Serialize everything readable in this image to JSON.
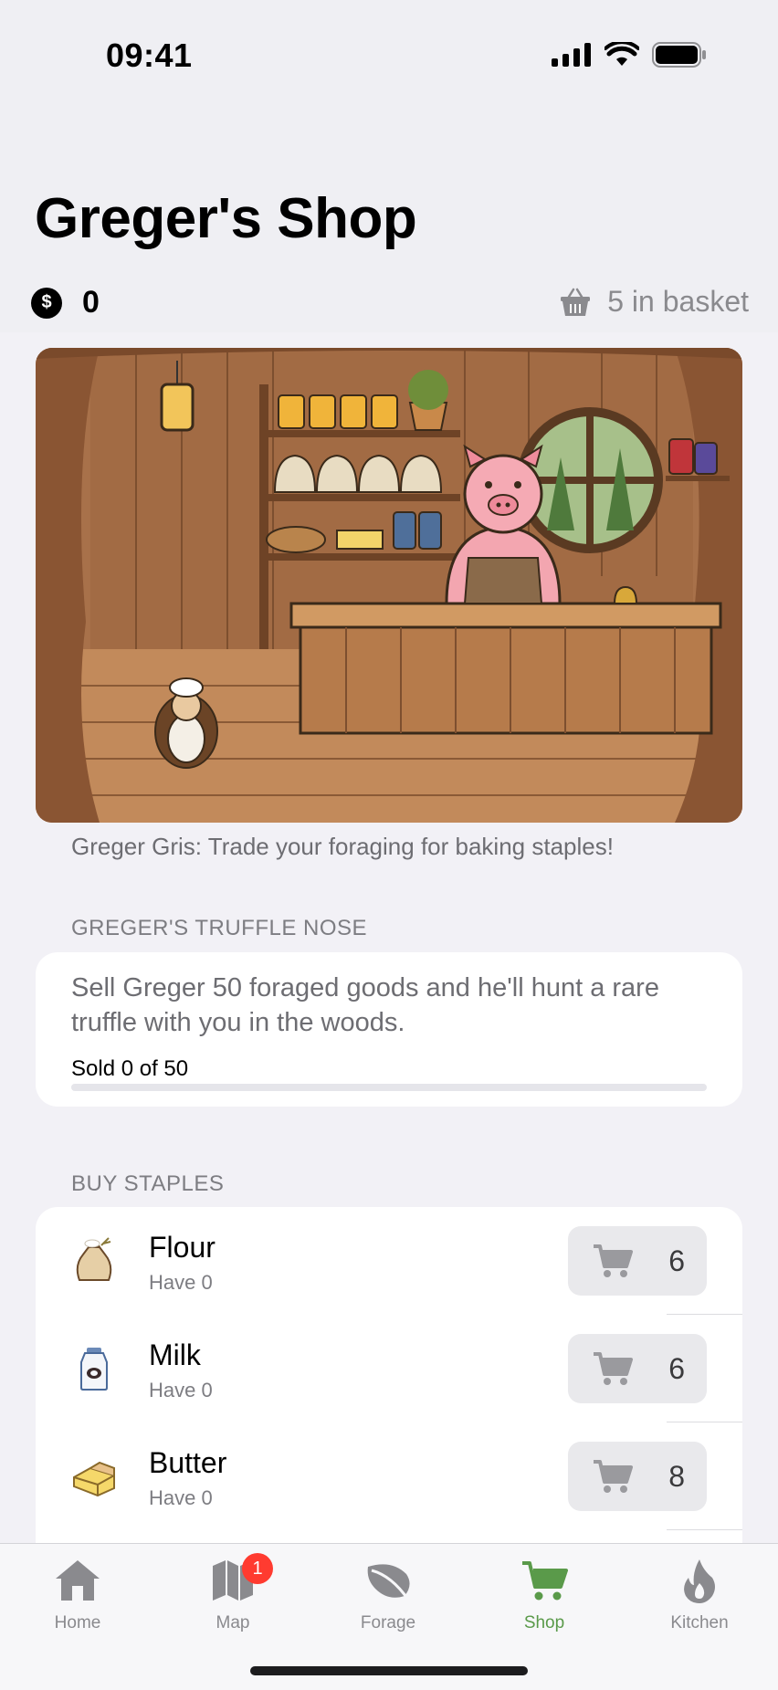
{
  "status": {
    "time": "09:41"
  },
  "header": {
    "title": "Greger's Shop",
    "coins": "0",
    "coin_symbol": "$",
    "basket": "5 in basket"
  },
  "scene": {
    "caption": "Greger Gris: Trade your foraging for baking staples!"
  },
  "truffle": {
    "section_title": "GREGER'S TRUFFLE NOSE",
    "description": "Sell Greger 50 foraged goods and he'll hunt a rare truffle with you in the woods.",
    "sold_label": "Sold 0 of 50",
    "progress": 0
  },
  "staples": {
    "section_title": "BUY STAPLES",
    "items": [
      {
        "name": "Flour",
        "have": "Have 0",
        "price": "6",
        "icon": "flour-sack-icon"
      },
      {
        "name": "Milk",
        "have": "Have 0",
        "price": "6",
        "icon": "milk-bottle-icon"
      },
      {
        "name": "Butter",
        "have": "Have 0",
        "price": "8",
        "icon": "butter-icon"
      }
    ]
  },
  "tabs": [
    {
      "label": "Home",
      "icon": "house-icon",
      "active": false
    },
    {
      "label": "Map",
      "icon": "map-icon",
      "active": false,
      "badge": "1"
    },
    {
      "label": "Forage",
      "icon": "leaf-icon",
      "active": false
    },
    {
      "label": "Shop",
      "icon": "cart-icon",
      "active": true
    },
    {
      "label": "Kitchen",
      "icon": "flame-icon",
      "active": false
    }
  ],
  "colors": {
    "accent": "#5a9a4a",
    "badge": "#ff3b30",
    "background": "#f2f1f6"
  }
}
